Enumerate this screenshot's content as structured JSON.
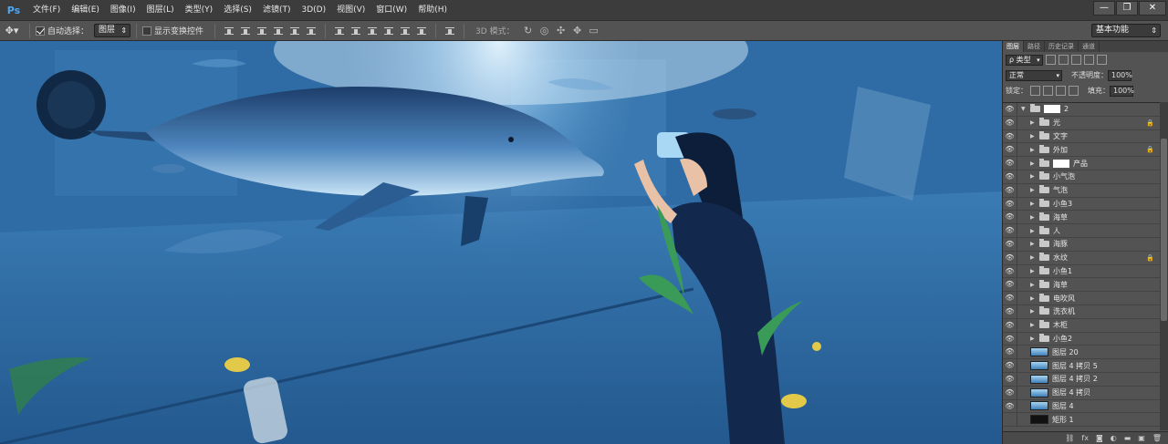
{
  "app": {
    "logo": "Ps"
  },
  "menu": [
    "文件(F)",
    "编辑(E)",
    "图像(I)",
    "图层(L)",
    "类型(Y)",
    "选择(S)",
    "滤镜(T)",
    "3D(D)",
    "视图(V)",
    "窗口(W)",
    "帮助(H)"
  ],
  "window_controls": {
    "minimize": "—",
    "restore": "❐",
    "close": "✕"
  },
  "options": {
    "auto_select_label": "自动选择：",
    "auto_select_checked": true,
    "auto_select_value": "图层",
    "show_transform_label": "显示变换控件",
    "mode_3d_label": "3D 模式：",
    "workspace": "基本功能"
  },
  "panel": {
    "tabs": [
      "图层",
      "路径",
      "历史记录",
      "通道"
    ],
    "filter_type": "ρ 类型",
    "blend_mode": "正常",
    "opacity_label": "不透明度：",
    "opacity_value": "100%",
    "lock_label": "锁定：",
    "fill_label": "填充：",
    "fill_value": "100%",
    "layers": [
      {
        "name": "2",
        "kind": "group-mask",
        "lock": false,
        "expanded": true
      },
      {
        "name": "光",
        "kind": "group",
        "lock": true
      },
      {
        "name": "文字",
        "kind": "group",
        "lock": false
      },
      {
        "name": "外加",
        "kind": "group",
        "lock": true
      },
      {
        "name": "产品",
        "kind": "group-mask",
        "lock": false
      },
      {
        "name": "小气泡",
        "kind": "group",
        "lock": false
      },
      {
        "name": "气泡",
        "kind": "group",
        "lock": false
      },
      {
        "name": "小鱼3",
        "kind": "group",
        "lock": false
      },
      {
        "name": "海草",
        "kind": "group",
        "lock": false
      },
      {
        "name": "人",
        "kind": "group",
        "lock": false
      },
      {
        "name": "海豚",
        "kind": "group",
        "lock": false
      },
      {
        "name": "水纹",
        "kind": "group",
        "lock": true
      },
      {
        "name": "小鱼1",
        "kind": "group",
        "lock": false
      },
      {
        "name": "海草",
        "kind": "group",
        "lock": false
      },
      {
        "name": "电吹风",
        "kind": "group",
        "lock": false
      },
      {
        "name": "洗衣机",
        "kind": "group",
        "lock": false
      },
      {
        "name": "木柜",
        "kind": "group",
        "lock": false
      },
      {
        "name": "小鱼2",
        "kind": "group",
        "lock": false
      },
      {
        "name": "图层 20",
        "kind": "image",
        "lock": false
      },
      {
        "name": "图层 4 拷贝 5",
        "kind": "image",
        "lock": false
      },
      {
        "name": "图层 4 拷贝 2",
        "kind": "image",
        "lock": false
      },
      {
        "name": "图层 4 拷贝",
        "kind": "image",
        "lock": false
      },
      {
        "name": "图层 4",
        "kind": "image",
        "lock": false
      },
      {
        "name": "矩形 1",
        "kind": "dark",
        "lock": false,
        "hidden": true
      }
    ],
    "footer_icons": [
      "link-icon",
      "fx-icon",
      "mask-icon",
      "adjustment-icon",
      "folder-icon",
      "new-layer-icon",
      "trash-icon"
    ]
  }
}
